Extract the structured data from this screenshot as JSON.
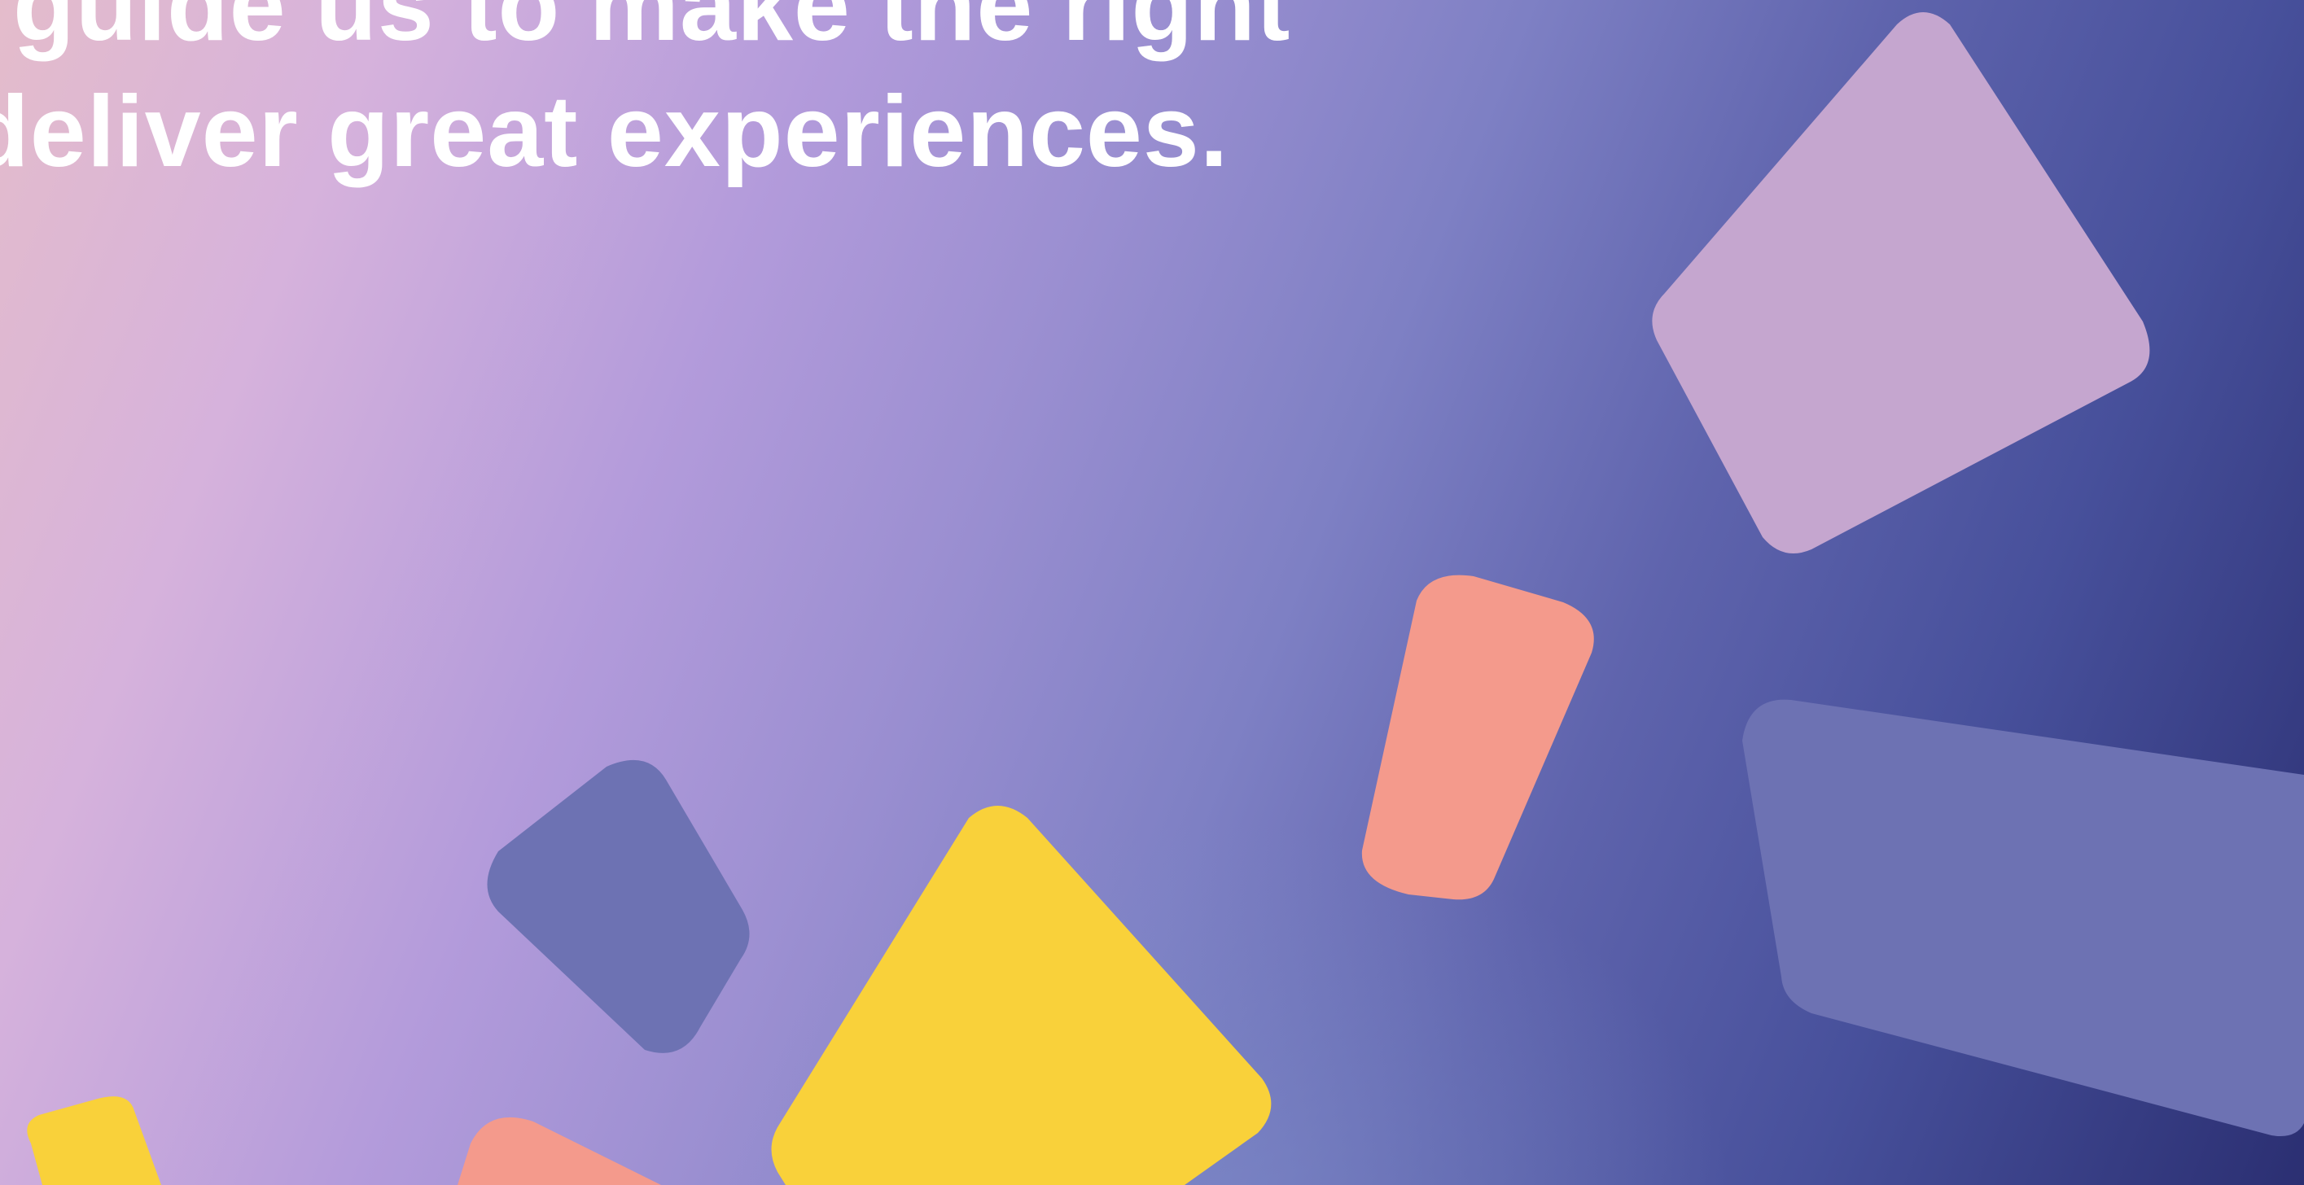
{
  "hero": {
    "headline_line_1": "guide us to make the right",
    "headline_line_2": "deliver great experiences."
  },
  "colors": {
    "text": "#ffffff",
    "shape_lilac": "#c5a6cf",
    "shape_indigo": "#6d72b3",
    "shape_salmon": "#f49a8c",
    "shape_yellow": "#f9d13a"
  }
}
